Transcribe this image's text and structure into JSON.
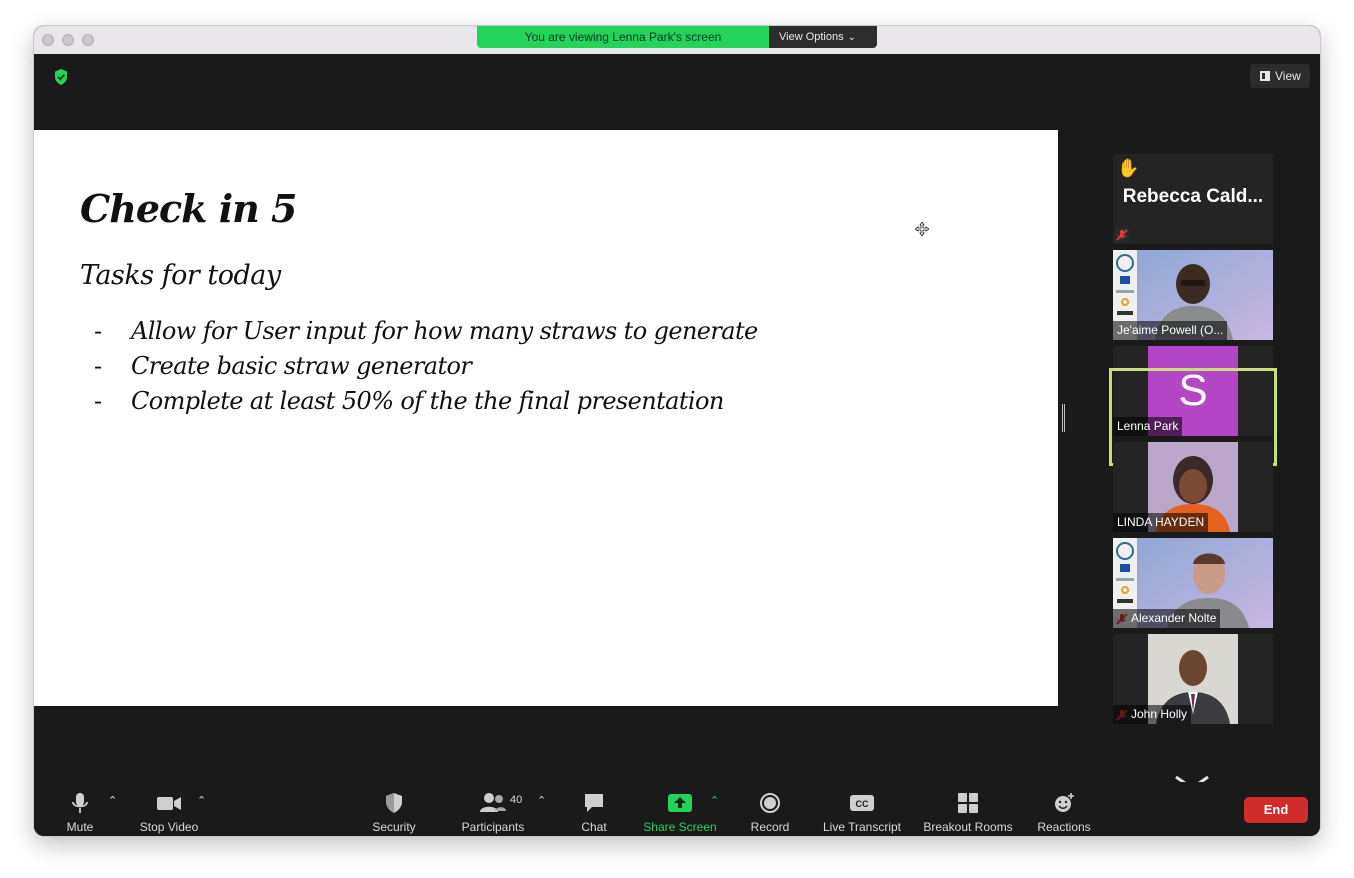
{
  "banner": {
    "text": "You are viewing Lenna Park's screen",
    "view_options": "View Options"
  },
  "top_right": {
    "view_label": "View"
  },
  "slide": {
    "title": "Check in 5",
    "subtitle": "Tasks for today",
    "bullets": [
      "Allow for User input for how many straws to generate",
      "Create basic straw generator",
      "Complete at least 50% of the the final presentation"
    ],
    "bullet_marker": "-"
  },
  "participants": [
    {
      "name": "Rebecca Cald...",
      "hand_raised": true,
      "muted": true,
      "type": "name-only"
    },
    {
      "name": "Je'aime Powell (O...",
      "muted": false,
      "type": "video"
    },
    {
      "name": "Lenna Park",
      "muted": false,
      "type": "avatar",
      "initial": "S",
      "active_speaker": true
    },
    {
      "name": "LINDA HAYDEN",
      "muted": false,
      "type": "video"
    },
    {
      "name": "Alexander Nolte",
      "muted": true,
      "type": "video"
    },
    {
      "name": "John Holly",
      "muted": true,
      "type": "video"
    }
  ],
  "toolbar": {
    "mute": "Mute",
    "stop_video": "Stop Video",
    "security": "Security",
    "participants": "Participants",
    "participants_count": "40",
    "chat": "Chat",
    "share_screen": "Share Screen",
    "record": "Record",
    "live_transcript": "Live Transcript",
    "breakout_rooms": "Breakout Rooms",
    "reactions": "Reactions",
    "end": "End"
  },
  "colors": {
    "banner_green": "#23d25a",
    "active_speaker_border": "#c9e07a",
    "end_red": "#d22b2b",
    "avatar_purple": "#b246c4"
  }
}
